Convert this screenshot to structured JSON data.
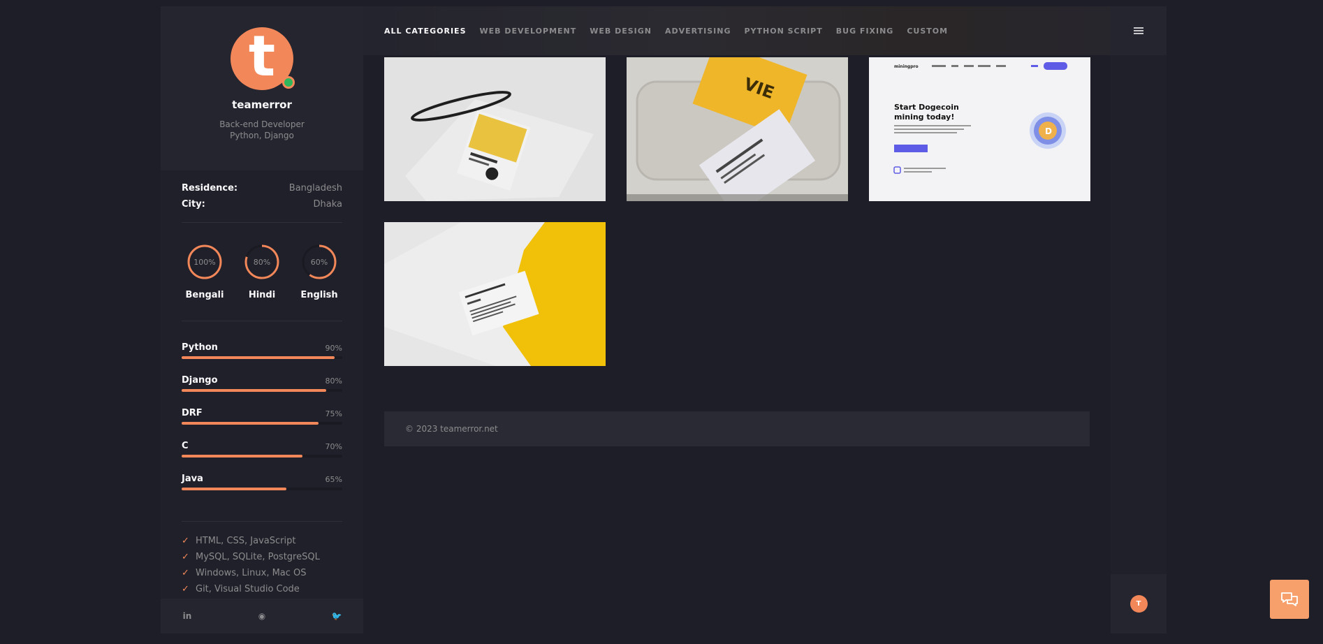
{
  "profile": {
    "avatar_letter": "t",
    "name": "teamerror",
    "role_line1": "Back-end Developer",
    "role_line2": "Python, Django"
  },
  "info": [
    {
      "key": "Residence:",
      "value": "Bangladesh"
    },
    {
      "key": "City:",
      "value": "Dhaka"
    }
  ],
  "languages": [
    {
      "name": "Bengali",
      "percent_label": "100%",
      "level": 1.0
    },
    {
      "name": "Hindi",
      "percent_label": "80%",
      "level": 0.8
    },
    {
      "name": "English",
      "percent_label": "60%",
      "level": 0.6
    }
  ],
  "skills": [
    {
      "name": "Python",
      "percent_label": "90%",
      "level": 0.95
    },
    {
      "name": "Django",
      "percent_label": "80%",
      "level": 0.9
    },
    {
      "name": "DRF",
      "percent_label": "75%",
      "level": 0.85
    },
    {
      "name": "C",
      "percent_label": "70%",
      "level": 0.75
    },
    {
      "name": "Java",
      "percent_label": "65%",
      "level": 0.65
    }
  ],
  "tools": [
    "HTML, CSS, JavaScript",
    "MySQL, SQLite, PostgreSQL",
    "Windows, Linux, Mac OS",
    "Git, Visual Studio Code"
  ],
  "social_icons": [
    "linkedin-icon",
    "github-icon",
    "twitter-icon"
  ],
  "social_glyphs": [
    "in",
    "◉",
    "🐦"
  ],
  "nav": {
    "tabs": [
      "ALL CATEGORIES",
      "WEB DEVELOPMENT",
      "WEB DESIGN",
      "ADVERTISING",
      "PYTHON SCRIPT",
      "BUG FIXING",
      "CUSTOM"
    ],
    "active": 0
  },
  "portfolio": {
    "tile3": {
      "brand": "miningpro",
      "headline1": "Start Dogecoin",
      "headline2": "mining today!"
    }
  },
  "footer": {
    "copyright": "© 2023 teamerror.net"
  },
  "rail": {
    "avatar_letter": "T"
  },
  "colors": {
    "accent": "#f2885a",
    "online": "#2fb65c",
    "background": "#1e1e28"
  }
}
